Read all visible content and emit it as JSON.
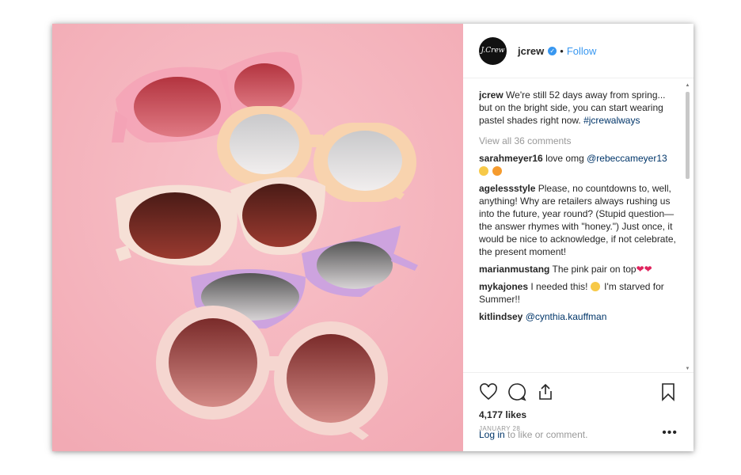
{
  "post": {
    "username": "jcrew",
    "avatar_text": "J.Crew",
    "separator": "•",
    "follow_label": "Follow"
  },
  "caption": {
    "username": "jcrew",
    "text": "We're still 52 days away from spring... but on the bright side, you can start wearing pastel shades right now.",
    "hashtag": "#jcrewalways"
  },
  "view_all_comments": "View all 36 comments",
  "comments": [
    {
      "user": "sarahmeyer16",
      "text": "love omg ",
      "mention": "@rebeccameyer13"
    },
    {
      "user": "agelessstyle",
      "text": "Please, no countdowns to, well, anything! Why are retailers always rushing us into the future, year round? (Stupid question—the answer rhymes with \"honey.\") Just once, it would be nice to acknowledge, if not celebrate, the present moment!"
    },
    {
      "user": "marianmustang",
      "text": "The pink pair on top"
    },
    {
      "user": "mykajones",
      "text": "I needed this! ",
      "text2": " I'm starved for Summer!!"
    },
    {
      "user": "kitlindsey",
      "mention": "@cynthia.kauffman"
    }
  ],
  "actions": {
    "likes": "4,177 likes",
    "date": "JANUARY 28",
    "login_link": "Log in",
    "login_text": " to like or comment.",
    "more": "•••"
  },
  "icons": [
    "heart-icon",
    "comment-icon",
    "share-icon",
    "bookmark-icon",
    "verified-badge-icon",
    "more-options-icon"
  ],
  "colors": {
    "link_blue": "#3897f0",
    "photo_background": "#f6b9c1",
    "heart_red": "#e0245e"
  }
}
